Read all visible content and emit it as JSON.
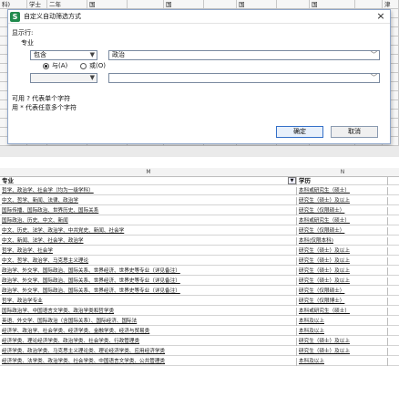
{
  "background": {
    "rows": [
      [
        "科)",
        "学士",
        "二年",
        "国",
        "",
        "国",
        "",
        "国",
        "",
        "国",
        "",
        "津"
      ],
      [
        "",
        "",
        "",
        "",
        "",
        "",
        "",
        "",
        "",
        "",
        "",
        ""
      ],
      [
        "",
        "",
        "",
        "",
        "",
        "",
        "",
        "",
        "",
        "",
        "",
        ""
      ],
      [
        "",
        "",
        "",
        "",
        "",
        "",
        "",
        "",
        "",
        "",
        "",
        ""
      ],
      [
        "",
        "",
        "",
        "",
        "",
        "",
        "",
        "",
        "",
        "",
        "",
        ""
      ],
      [
        "",
        "",
        "",
        "",
        "",
        "",
        "",
        "",
        "",
        "",
        "",
        ""
      ],
      [
        "",
        "",
        "",
        "",
        "",
        "",
        "",
        "",
        "",
        "",
        "",
        ""
      ],
      [
        "",
        "",
        "",
        "",
        "",
        "",
        "",
        "",
        "",
        "",
        "",
        ""
      ],
      [
        "",
        "",
        "",
        "",
        "",
        "",
        "",
        "",
        "",
        "",
        "",
        ""
      ],
      [
        "",
        "",
        "",
        "",
        "",
        "",
        "",
        "",
        "",
        "",
        "",
        ""
      ],
      [
        "",
        "",
        "",
        "",
        "",
        "",
        "",
        "",
        "",
        "",
        "",
        ""
      ],
      [
        "",
        "",
        "",
        "",
        "",
        "",
        "",
        "",
        "",
        "",
        "",
        ""
      ],
      [
        "",
        "",
        "",
        "",
        "",
        "",
        "",
        "",
        "",
        "",
        "",
        ""
      ],
      [
        "",
        "",
        "",
        "",
        "",
        "",
        "",
        "",
        "",
        "",
        "",
        ""
      ],
      [
        "",
        "",
        "",
        "",
        "",
        "",
        "",
        "",
        "",
        "",
        "",
        ""
      ],
      [
        "",
        "",
        "",
        "",
        "",
        "",
        "",
        "",
        "",
        "",
        "",
        ""
      ]
    ]
  },
  "dialog": {
    "app_icon": "S",
    "title": "自定义自动筛选方式",
    "close_label": "×",
    "show_rows_label": "显示行:",
    "field_label": "专业",
    "condition1": {
      "operator": "包含",
      "value": "政治"
    },
    "and_label": "与(A)",
    "or_label": "或(O)",
    "logic": "and",
    "condition2": {
      "operator": "",
      "value": ""
    },
    "hint1": "可用 ? 代表单个字符",
    "hint2": "用 * 代表任意多个字符",
    "ok_label": "确定",
    "cancel_label": "取消"
  },
  "sheet": {
    "columns": [
      "M",
      "N"
    ],
    "header": {
      "m": "专业",
      "n": "学历"
    },
    "rows": [
      {
        "m": "哲学、政治学、社会学（均为一级学科）",
        "n": "本科或研究生（硕士）"
      },
      {
        "m": "中文、哲学、新闻、法律、政治学",
        "n": "研究生（硕士）及以上"
      },
      {
        "m": "国际传播、国际政治、世界历史、国际关系",
        "n": "研究生（仅限硕士）"
      },
      {
        "m": "国际政治、历史、中文、新闻",
        "n": "本科或研究生（硕士）"
      },
      {
        "m": "中文、历史、法学、政治学、中共党史、新闻、社会学",
        "n": "研究生（仅限硕士）"
      },
      {
        "m": "中文、新闻、法学、社会学、政治学",
        "n": "本科(仅限本科)"
      },
      {
        "m": "哲学、政治学、社会学",
        "n": "研究生（硕士）及以上"
      },
      {
        "m": "中文、哲学、政治学、马克思主义理论",
        "n": "研究生（硕士）及以上"
      },
      {
        "m": "政治学、外交学、国际政治、国际关系、世界经济、世界史等专业（详见备注）",
        "n": "研究生（硕士）及以上"
      },
      {
        "m": "政治学、外交学、国际政治、国际关系、世界经济、世界史等专业（详见备注）",
        "n": "研究生（硕士）及以上"
      },
      {
        "m": "政治学、外交学、国际政治、国际关系、世界经济、世界史等专业（详见备注）",
        "n": "研究生（仅限硕士）"
      },
      {
        "m": "哲学、政治学专业",
        "n": "研究生（仅限博士）"
      },
      {
        "m": "国际政治学、中国语言文学类、政治学类和哲学类",
        "n": "本科或研究生（硕士）"
      },
      {
        "m": "英语、外交学、国际政治（含国际关系）、国际经济、国际法",
        "n": "本科及以上"
      },
      {
        "m": "经济学、政治学、社会学类、经济学类、金融学类、经济与贸易类",
        "n": "本科及以上"
      },
      {
        "m": "经济学类、理论经济学类、政治学类、社会学类、行政管理类",
        "n": "研究生（硕士）及以上"
      },
      {
        "m": "经济学类、政治学类、马克思主义理论类、理论经济学类、应用经济学类",
        "n": "研究生（硕士）及以上"
      },
      {
        "m": "经济学类、法学类、政治学类、社会学类、中国语言文学类、公共管理类",
        "n": "本科及以上"
      }
    ]
  },
  "colors": {
    "dialog_border": "#8fa6c9",
    "app_icon": "#1f8a4c",
    "primary_button_border": "#3470c8"
  }
}
